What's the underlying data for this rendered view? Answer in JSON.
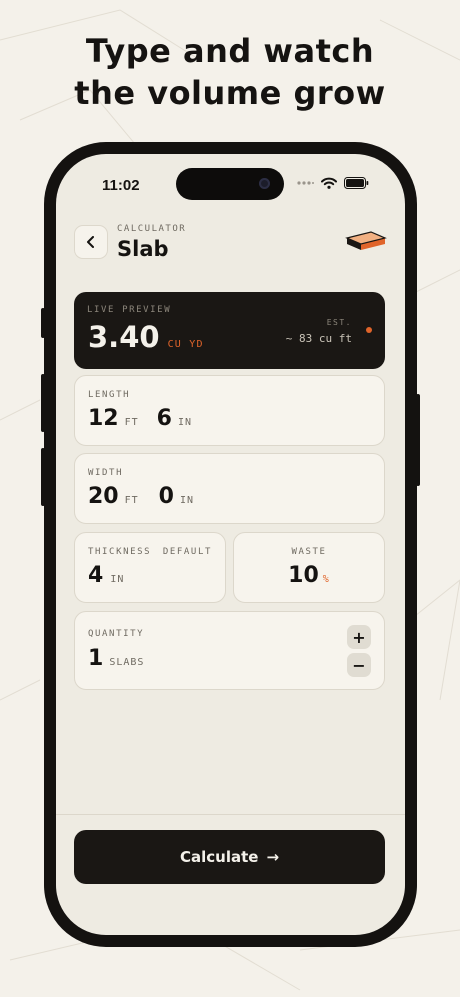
{
  "headline": {
    "line1": "Type and watch",
    "line2": "the volume grow"
  },
  "status": {
    "time": "11:02"
  },
  "nav": {
    "kicker": "CALCULATOR",
    "title": "Slab"
  },
  "preview": {
    "label": "LIVE PREVIEW",
    "value": "3.40",
    "unit": "CU YD",
    "est_label": "EST.",
    "est_value": "~ 83 cu ft"
  },
  "length": {
    "label": "LENGTH",
    "feet": "12",
    "feet_unit": "FT",
    "inches": "6",
    "inches_unit": "IN"
  },
  "width": {
    "label": "WIDTH",
    "feet": "20",
    "feet_unit": "FT",
    "inches": "0",
    "inches_unit": "IN"
  },
  "thickness": {
    "label": "THICKNESS",
    "tag": "DEFAULT",
    "value": "4",
    "unit": "IN"
  },
  "waste": {
    "label": "WASTE",
    "value": "10",
    "unit": "%"
  },
  "quantity": {
    "label": "QUANTITY",
    "value": "1",
    "unit": "SLABS",
    "plus": "+",
    "minus": "−"
  },
  "action": {
    "label": "Calculate",
    "arrow": "→"
  },
  "colors": {
    "accent": "#e0642a",
    "dark": "#1a1714",
    "background": "#f4f1ea",
    "card": "#f7f4ed"
  }
}
